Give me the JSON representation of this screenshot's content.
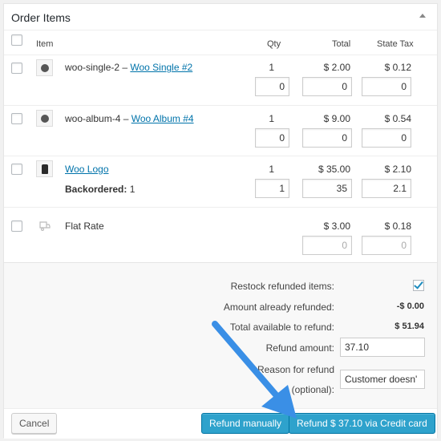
{
  "panel": {
    "title": "Order Items"
  },
  "columns": {
    "item": "Item",
    "qty": "Qty",
    "total": "Total",
    "tax": "State Tax"
  },
  "rows": [
    {
      "sku": "woo-single-2 – ",
      "link": "Woo Single #2",
      "qty": "1",
      "total": "$ 2.00",
      "tax": "$ 0.12",
      "refund_qty": "0",
      "refund_total": "0",
      "refund_tax": "0"
    },
    {
      "sku": "woo-album-4 – ",
      "link": "Woo Album #4",
      "qty": "1",
      "total": "$ 9.00",
      "tax": "$ 0.54",
      "refund_qty": "0",
      "refund_total": "0",
      "refund_tax": "0"
    },
    {
      "sku": "",
      "link": "Woo Logo",
      "qty": "1",
      "total": "$ 35.00",
      "tax": "$ 2.10",
      "refund_qty": "1",
      "refund_total": "35",
      "refund_tax": "2.1",
      "meta_label": "Backordered:",
      "meta_value": " 1"
    }
  ],
  "shipping": {
    "name": "Flat Rate",
    "total": "$ 3.00",
    "tax": "$ 0.18",
    "refund_total_placeholder": "0",
    "refund_tax_placeholder": "0"
  },
  "refund": {
    "restock_label": "Restock refunded items:",
    "restock_checked": true,
    "already_label": "Amount already refunded:",
    "already_value": "-$ 0.00",
    "available_label": "Total available to refund:",
    "available_value": "$ 51.94",
    "amount_label": "Refund amount:",
    "amount_value": "37.10",
    "reason_label_1": "Reason for refund",
    "reason_label_2": "(optional):",
    "reason_value": "Customer doesn'"
  },
  "footer": {
    "cancel": "Cancel",
    "refund_manually": "Refund manually",
    "refund_gateway": "Refund $ 37.10 via Credit card"
  },
  "colors": {
    "link": "#0073aa",
    "primary": "#2ea2cc",
    "arrow": "#3a8fe6"
  }
}
